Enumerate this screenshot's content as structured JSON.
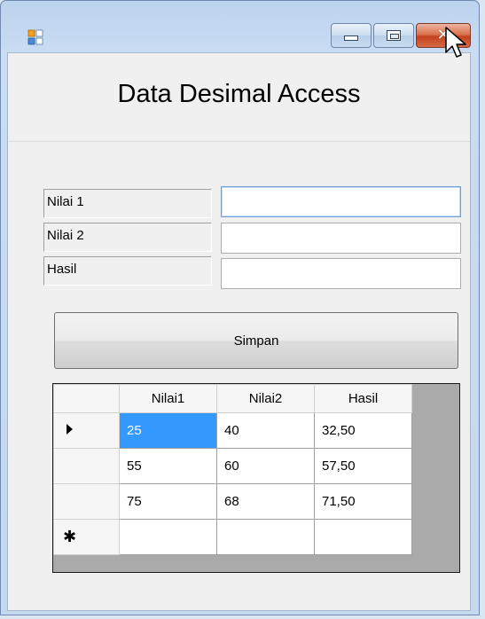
{
  "window": {
    "close_glyph": "✕"
  },
  "header": {
    "title": "Data Desimal Access"
  },
  "form": {
    "fields": [
      {
        "label": "Nilai 1",
        "value": ""
      },
      {
        "label": "Nilai 2",
        "value": ""
      },
      {
        "label": "Hasil",
        "value": ""
      }
    ],
    "save_label": "Simpan"
  },
  "grid": {
    "columns": [
      "Nilai1",
      "Nilai2",
      "Hasil"
    ],
    "rows": [
      [
        "25",
        "40",
        "32,50"
      ],
      [
        "55",
        "60",
        "57,50"
      ],
      [
        "75",
        "68",
        "71,50"
      ]
    ],
    "new_row_glyph": "✱"
  },
  "colors": {
    "selection": "#3399ff",
    "close_button": "#c5421d"
  }
}
